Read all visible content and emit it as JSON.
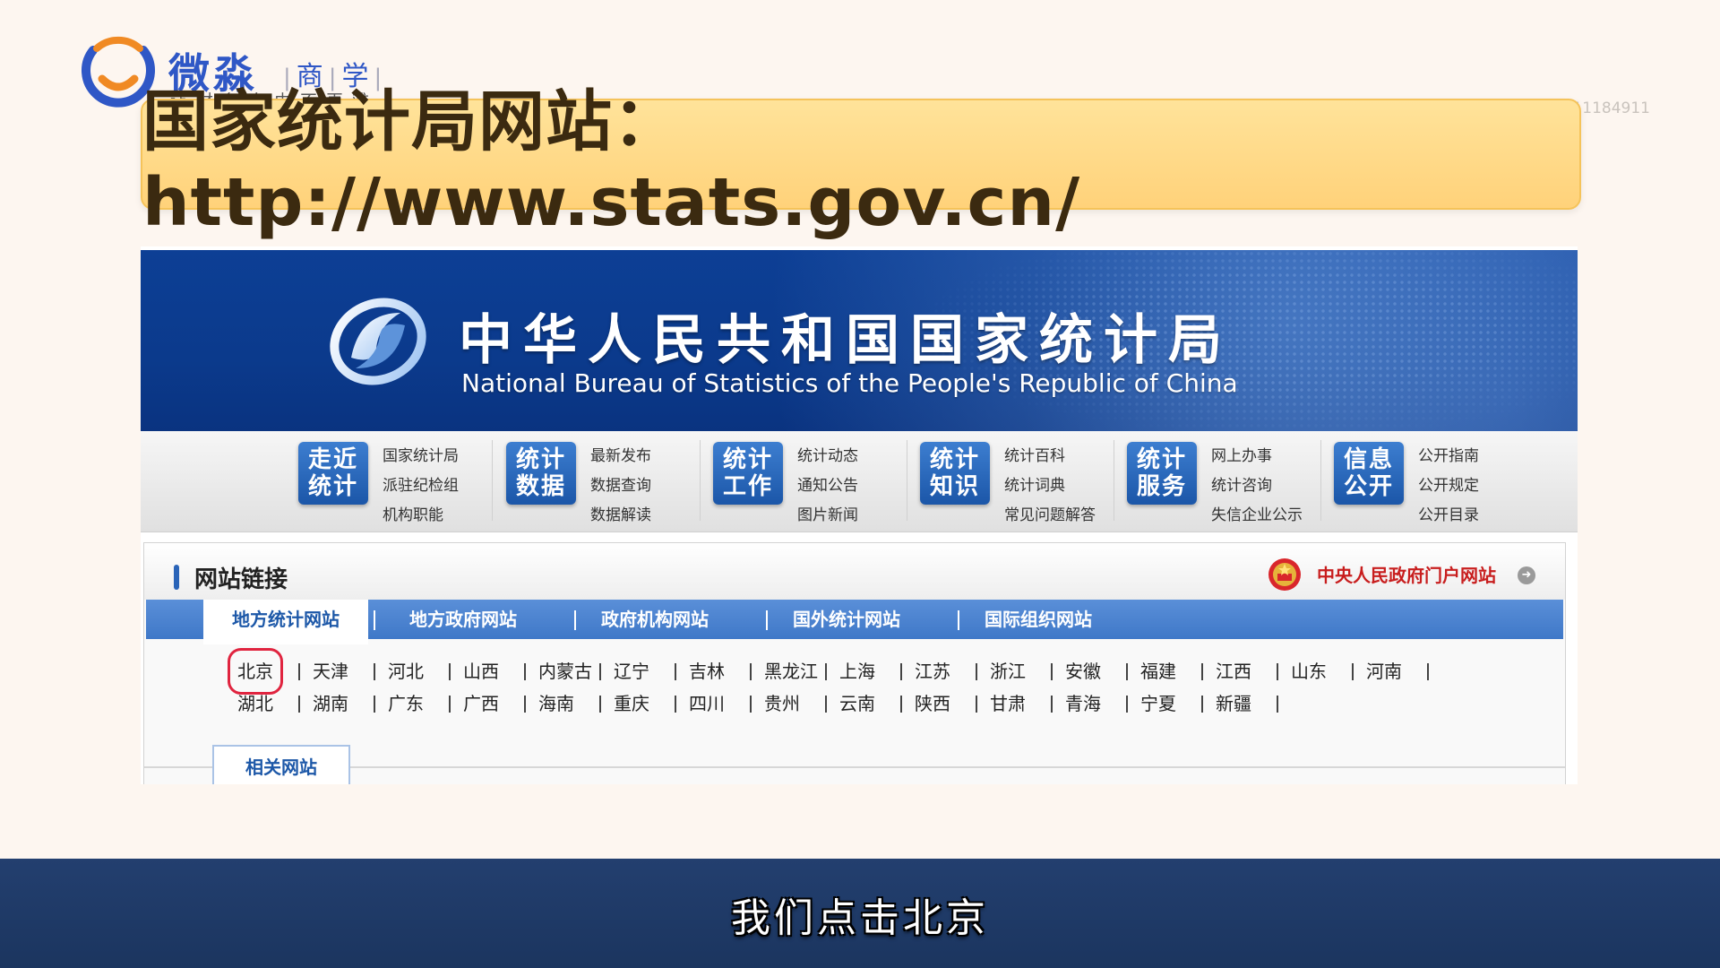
{
  "brand": {
    "name": "微淼",
    "sub": [
      "商",
      "学",
      "院"
    ],
    "slogan": "让财务自由不再难"
  },
  "student_id": "学号：11184911",
  "banner": {
    "title": "国家统计局网站：http://www.stats.gov.cn/"
  },
  "site": {
    "cn_title": "中华人民共和国国家统计局",
    "en_title": "National Bureau of Statistics of the People's Republic of China",
    "nav": [
      {
        "badge": [
          "走近",
          "统计"
        ],
        "links": [
          "国家统计局",
          "派驻纪检组",
          "机构职能"
        ]
      },
      {
        "badge": [
          "统计",
          "数据"
        ],
        "links": [
          "最新发布",
          "数据查询",
          "数据解读"
        ]
      },
      {
        "badge": [
          "统计",
          "工作"
        ],
        "links": [
          "统计动态",
          "通知公告",
          "图片新闻"
        ]
      },
      {
        "badge": [
          "统计",
          "知识"
        ],
        "links": [
          "统计百科",
          "统计词典",
          "常见问题解答"
        ]
      },
      {
        "badge": [
          "统计",
          "服务"
        ],
        "links": [
          "网上办事",
          "统计咨询",
          "失信企业公示"
        ]
      },
      {
        "badge": [
          "信息",
          "公开"
        ],
        "links": [
          "公开指南",
          "公开规定",
          "公开目录"
        ]
      }
    ],
    "links_panel": {
      "title": "网站链接",
      "gov_link": "中央人民政府门户网站",
      "gov_arrow": "➜",
      "tabs": [
        "地方统计网站",
        "地方政府网站",
        "政府机构网站",
        "国外统计网站",
        "国际组织网站"
      ],
      "tab_separator": "|",
      "regions_row1": [
        "北京",
        "天津",
        "河北",
        "山西",
        "内蒙古",
        "辽宁",
        "吉林",
        "黑龙江",
        "上海",
        "江苏",
        "浙江",
        "安徽",
        "福建",
        "江西",
        "山东",
        "河南"
      ],
      "regions_row2": [
        "湖北",
        "湖南",
        "广东",
        "广西",
        "海南",
        "重庆",
        "四川",
        "贵州",
        "云南",
        "陕西",
        "甘肃",
        "青海",
        "宁夏",
        "新疆"
      ],
      "highlighted_region": "北京",
      "sub_tab": "相关网站"
    }
  },
  "caption": "我们点击北京",
  "colors": {
    "brand_blue": "#2f57c6",
    "brand_orange": "#f08a24",
    "header_blue": "#0d3f95",
    "tab_blue": "#4a82cf",
    "highlight_red": "#e0243f",
    "gov_red": "#c81e1e"
  }
}
